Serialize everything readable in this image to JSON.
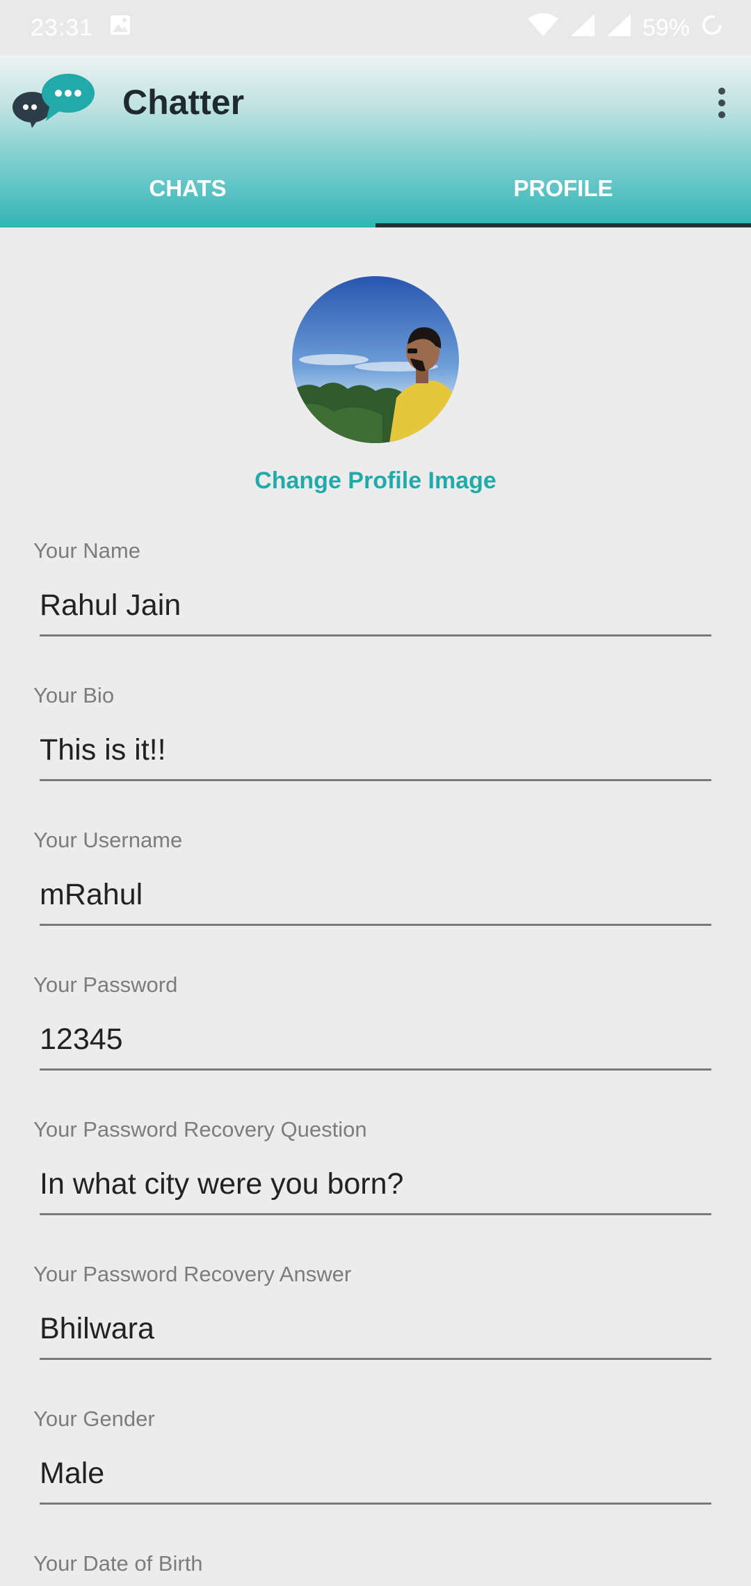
{
  "status_bar": {
    "time": "23:31",
    "battery": "59%",
    "icons": [
      "image-icon",
      "wifi-icon",
      "signal-icon",
      "signal-r-icon",
      "battery-saver-icon"
    ]
  },
  "app_bar": {
    "title": "Chatter",
    "logo_icon": "chat-bubbles-logo-icon",
    "menu_icon": "more-vert-icon"
  },
  "tabs": [
    {
      "label": "CHATS",
      "active": false
    },
    {
      "label": "PROFILE",
      "active": true
    }
  ],
  "profile": {
    "change_image_label": "Change Profile Image",
    "fields": [
      {
        "label": "Your Name",
        "value": "Rahul Jain"
      },
      {
        "label": "Your Bio",
        "value": "This is it!!"
      },
      {
        "label": "Your Username",
        "value": "mRahul"
      },
      {
        "label": "Your Password",
        "value": "12345"
      },
      {
        "label": "Your Password Recovery Question",
        "value": "In what city were you born?"
      },
      {
        "label": "Your Password Recovery Answer",
        "value": "Bhilwara"
      },
      {
        "label": "Your Gender",
        "value": "Male"
      },
      {
        "label": "Your Date of Birth",
        "value": ""
      }
    ]
  },
  "colors": {
    "accent": "#22aaaa",
    "tab_indicator": "#1f3438",
    "background": "#ececec"
  }
}
